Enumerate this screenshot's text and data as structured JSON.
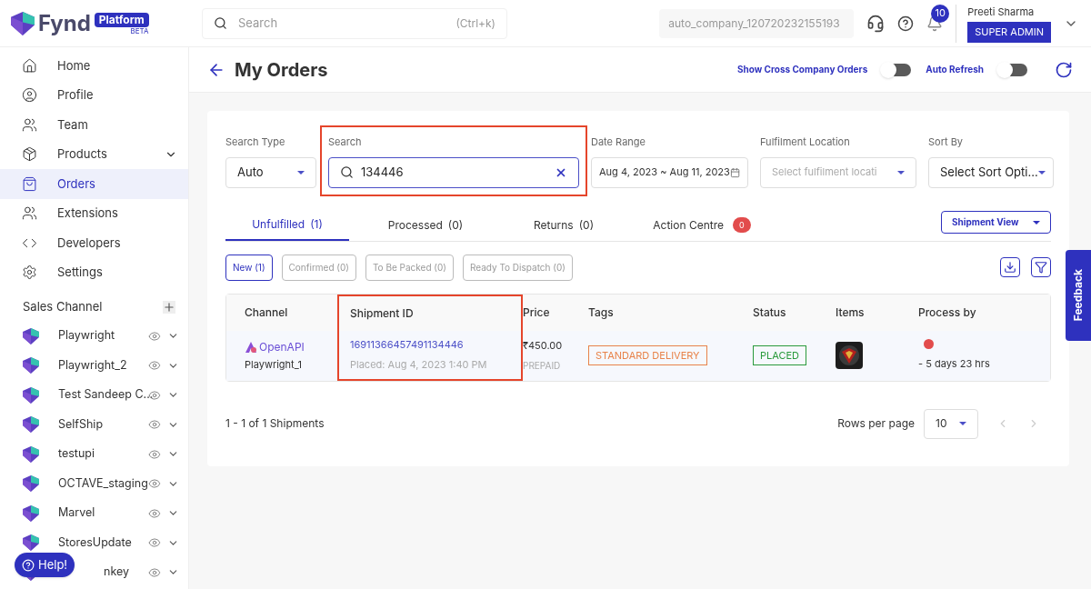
{
  "header": {
    "logo": {
      "name": "Fynd",
      "badge": "Platform",
      "tag": "BETA"
    },
    "search": {
      "placeholder": "Search",
      "shortcut": "(Ctrl+k)"
    },
    "company": "auto_company_120720232155193",
    "notifications": "10",
    "user": {
      "name": "Preeti Sharma",
      "role": "SUPER ADMIN"
    }
  },
  "sidebar": {
    "items": [
      {
        "label": "Home",
        "selected": false,
        "expandable": false
      },
      {
        "label": "Profile",
        "selected": false,
        "expandable": false
      },
      {
        "label": "Team",
        "selected": false,
        "expandable": false
      },
      {
        "label": "Products",
        "selected": false,
        "expandable": true
      },
      {
        "label": "Orders",
        "selected": true,
        "expandable": false
      },
      {
        "label": "Extensions",
        "selected": false,
        "expandable": false
      },
      {
        "label": "Developers",
        "selected": false,
        "expandable": false
      },
      {
        "label": "Settings",
        "selected": false,
        "expandable": false
      }
    ],
    "section": "Sales Channel",
    "channels": [
      "Playwright",
      "Playwright_2",
      "Test Sandeep C...",
      "SelfShip",
      "testupi",
      "OCTAVE_staging",
      "Marvel",
      "StoresUpdate",
      "nkey"
    ],
    "help": "Help!"
  },
  "page": {
    "title": "My Orders",
    "toggles": [
      {
        "label": "Show Cross Company Orders",
        "on": false
      },
      {
        "label": "Auto Refresh",
        "on": false
      }
    ]
  },
  "filters": [
    {
      "kind": "select",
      "label": "Search Type",
      "value": "Auto",
      "highlighted": false
    },
    {
      "kind": "search",
      "label": "Search",
      "value": "134446",
      "highlighted": true
    },
    {
      "kind": "date",
      "label": "Date Range",
      "value": "Aug 4, 2023 ~ Aug 11, 2023",
      "highlighted": false
    },
    {
      "kind": "select",
      "label": "Fulfilment Location",
      "placeholder": "Select fulfilment locati",
      "highlighted": false
    },
    {
      "kind": "select",
      "label": "Sort By",
      "value": "Select Sort Opti...",
      "highlighted": false
    }
  ],
  "tabs": [
    {
      "label": "Unfulfilled",
      "count": "(1)",
      "selected": true
    },
    {
      "label": "Processed",
      "count": "(0)",
      "selected": false
    },
    {
      "label": "Returns",
      "count": "(0)",
      "selected": false
    },
    {
      "label": "Action Centre",
      "badge": "0",
      "selected": false
    }
  ],
  "view_button": "Shipment View",
  "sub_filters": [
    {
      "label": "New (1)",
      "selected": true
    },
    {
      "label": "Confirmed (0)",
      "selected": false
    },
    {
      "label": "To Be Packed (0)",
      "selected": false
    },
    {
      "label": "Ready To Dispatch (0)",
      "selected": false
    }
  ],
  "table": {
    "columns": [
      {
        "label": "Channel",
        "highlighted": false
      },
      {
        "label": "Shipment ID",
        "highlighted": true
      },
      {
        "label": "Price",
        "highlighted": false
      },
      {
        "label": "Tags",
        "highlighted": false
      },
      {
        "label": "Status",
        "highlighted": false
      },
      {
        "label": "Items",
        "highlighted": false
      },
      {
        "label": "Process by",
        "highlighted": false
      }
    ],
    "rows": [
      {
        "channel_source": "OpenAPI",
        "channel_name": "Playwright_1",
        "shipment_id": "16911366457491134446",
        "placed": "Placed: Aug 4, 2023 1:40 PM",
        "price": "₹450.00",
        "payment": "PREPAID",
        "tag": "STANDARD DELIVERY",
        "status": "PLACED",
        "process_time": "- 5 days 23 hrs"
      }
    ]
  },
  "footer": {
    "summary": "1 - 1 of 1 Shipments",
    "rows_label": "Rows per page",
    "rows_value": "10"
  },
  "feedback": "Feedback"
}
